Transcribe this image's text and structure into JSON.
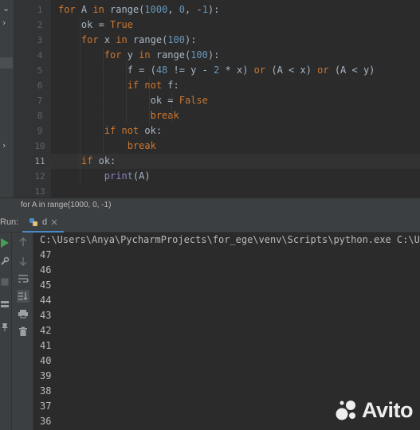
{
  "editor": {
    "line_numbers": [
      "1",
      "2",
      "3",
      "4",
      "5",
      "6",
      "7",
      "8",
      "9",
      "10",
      "11",
      "12",
      "13"
    ],
    "current_line": "11",
    "lines": [
      [
        {
          "t": "for ",
          "c": "kw"
        },
        {
          "t": "A ",
          "c": ""
        },
        {
          "t": "in ",
          "c": "kw"
        },
        {
          "t": "range",
          "c": ""
        },
        {
          "t": "(",
          "c": ""
        },
        {
          "t": "1000",
          "c": "num"
        },
        {
          "t": ", ",
          "c": ""
        },
        {
          "t": "0",
          "c": "num"
        },
        {
          "t": ", -",
          "c": ""
        },
        {
          "t": "1",
          "c": "num"
        },
        {
          "t": "):",
          "c": ""
        }
      ],
      [
        {
          "t": "    ok = ",
          "c": ""
        },
        {
          "t": "True",
          "c": "kw"
        }
      ],
      [
        {
          "t": "    ",
          "c": ""
        },
        {
          "t": "for ",
          "c": "kw"
        },
        {
          "t": "x ",
          "c": ""
        },
        {
          "t": "in ",
          "c": "kw"
        },
        {
          "t": "range(",
          "c": ""
        },
        {
          "t": "100",
          "c": "num"
        },
        {
          "t": "):",
          "c": ""
        }
      ],
      [
        {
          "t": "        ",
          "c": ""
        },
        {
          "t": "for ",
          "c": "kw"
        },
        {
          "t": "y ",
          "c": ""
        },
        {
          "t": "in ",
          "c": "kw"
        },
        {
          "t": "range(",
          "c": ""
        },
        {
          "t": "100",
          "c": "num"
        },
        {
          "t": "):",
          "c": ""
        }
      ],
      [
        {
          "t": "            f = (",
          "c": ""
        },
        {
          "t": "48",
          "c": "num"
        },
        {
          "t": " != y - ",
          "c": ""
        },
        {
          "t": "2",
          "c": "num"
        },
        {
          "t": " * x) ",
          "c": ""
        },
        {
          "t": "or",
          "c": "kw"
        },
        {
          "t": " (A < x) ",
          "c": ""
        },
        {
          "t": "or",
          "c": "kw"
        },
        {
          "t": " (A < y)",
          "c": ""
        }
      ],
      [
        {
          "t": "            ",
          "c": ""
        },
        {
          "t": "if not ",
          "c": "kw"
        },
        {
          "t": "f:",
          "c": ""
        }
      ],
      [
        {
          "t": "                ok = ",
          "c": ""
        },
        {
          "t": "False",
          "c": "kw"
        }
      ],
      [
        {
          "t": "                ",
          "c": ""
        },
        {
          "t": "break",
          "c": "kw"
        }
      ],
      [
        {
          "t": "        ",
          "c": ""
        },
        {
          "t": "if not ",
          "c": "kw"
        },
        {
          "t": "ok:",
          "c": ""
        }
      ],
      [
        {
          "t": "            ",
          "c": ""
        },
        {
          "t": "break",
          "c": "kw"
        }
      ],
      [
        {
          "t": "    ",
          "c": ""
        },
        {
          "t": "if ",
          "c": "kw"
        },
        {
          "t": "ok:",
          "c": ""
        }
      ],
      [
        {
          "t": "        ",
          "c": ""
        },
        {
          "t": "print",
          "c": "fn"
        },
        {
          "t": "(A)",
          "c": ""
        }
      ],
      []
    ]
  },
  "breadcrumb": "for A in range(1000, 0, -1)",
  "run": {
    "label": "Run:",
    "tab_label": "d",
    "command": "C:\\Users\\Anya\\PycharmProjects\\for_ege\\venv\\Scripts\\python.exe C:\\User",
    "output": [
      "47",
      "46",
      "45",
      "44",
      "43",
      "42",
      "41",
      "40",
      "39",
      "38",
      "37",
      "36"
    ]
  },
  "icons": {
    "run": "play-icon",
    "wrench": "wrench-icon",
    "stop": "stop-icon",
    "up": "arrow-up-icon",
    "down": "arrow-down-icon",
    "wrap": "soft-wrap-icon",
    "scroll": "scroll-to-end-icon",
    "print": "print-icon",
    "trash": "trash-icon",
    "pin": "pin-icon",
    "layout": "layout-icon"
  },
  "colors": {
    "editor_bg": "#2b2b2b",
    "keyword": "#cc7832",
    "number": "#6897bb",
    "builtin": "#8888c6",
    "text": "#a9b7c6",
    "run_green": "#499c54"
  },
  "watermark": "Avito"
}
